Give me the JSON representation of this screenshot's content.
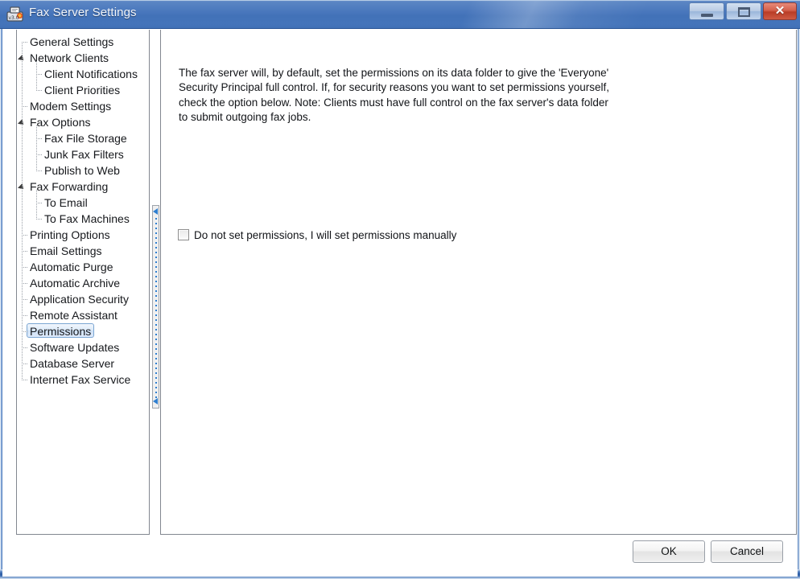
{
  "window": {
    "title": "Fax Server Settings",
    "icon": "fax-machine-icon",
    "controls": {
      "minimize_label": "Minimize",
      "maximize_label": "Maximize",
      "close_label": "Close",
      "close_glyph": "✕"
    },
    "accent_color": "#4272b8",
    "close_color": "#c24a32"
  },
  "tree": {
    "selected": "Permissions",
    "items": [
      {
        "label": "General Settings",
        "level": 0,
        "expander": "none"
      },
      {
        "label": "Network Clients",
        "level": 0,
        "expander": "expanded"
      },
      {
        "label": "Client Notifications",
        "level": 1,
        "expander": "none"
      },
      {
        "label": "Client Priorities",
        "level": 1,
        "expander": "none"
      },
      {
        "label": "Modem Settings",
        "level": 0,
        "expander": "none"
      },
      {
        "label": "Fax Options",
        "level": 0,
        "expander": "expanded"
      },
      {
        "label": "Fax File Storage",
        "level": 1,
        "expander": "none"
      },
      {
        "label": "Junk Fax Filters",
        "level": 1,
        "expander": "none"
      },
      {
        "label": "Publish to Web",
        "level": 1,
        "expander": "none"
      },
      {
        "label": "Fax Forwarding",
        "level": 0,
        "expander": "expanded"
      },
      {
        "label": "To Email",
        "level": 1,
        "expander": "none"
      },
      {
        "label": "To Fax Machines",
        "level": 1,
        "expander": "none"
      },
      {
        "label": "Printing Options",
        "level": 0,
        "expander": "none"
      },
      {
        "label": "Email Settings",
        "level": 0,
        "expander": "none"
      },
      {
        "label": "Automatic Purge",
        "level": 0,
        "expander": "none"
      },
      {
        "label": "Automatic Archive",
        "level": 0,
        "expander": "none"
      },
      {
        "label": "Application Security",
        "level": 0,
        "expander": "none"
      },
      {
        "label": "Remote Assistant",
        "level": 0,
        "expander": "none"
      },
      {
        "label": "Permissions",
        "level": 0,
        "expander": "none"
      },
      {
        "label": "Software Updates",
        "level": 0,
        "expander": "none"
      },
      {
        "label": "Database Server",
        "level": 0,
        "expander": "none"
      },
      {
        "label": "Internet Fax Service",
        "level": 0,
        "expander": "none"
      }
    ]
  },
  "splitter": {
    "collapse_arrow_top": "collapse-left-arrow",
    "collapse_arrow_bottom": "collapse-left-arrow"
  },
  "content": {
    "description": "The fax server will, by default, set the permissions on its data folder to give the 'Everyone' Security Principal full control.  If, for security reasons you want to set permissions yourself, check the option below.  Note:  Clients must have full control on the fax server's data folder to submit outgoing fax jobs.",
    "checkbox": {
      "label": "Do not set permissions, I will set permissions manually",
      "checked": false
    }
  },
  "footer": {
    "ok_label": "OK",
    "cancel_label": "Cancel"
  }
}
